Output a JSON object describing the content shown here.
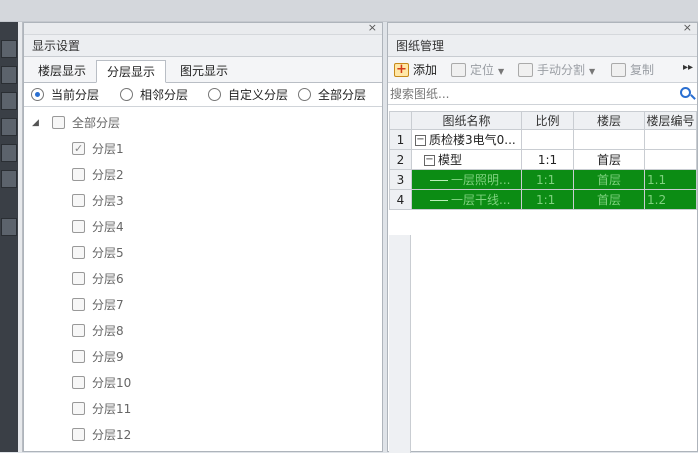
{
  "left_panel": {
    "title": "显示设置",
    "tabs": [
      "楼层显示",
      "分层显示",
      "图元显示"
    ],
    "active_tab": 1,
    "radios": [
      {
        "label": "当前分层",
        "selected": true
      },
      {
        "label": "相邻分层",
        "selected": false
      },
      {
        "label": "自定义分层",
        "selected": false
      },
      {
        "label": "全部分层",
        "selected": false
      }
    ],
    "tree": {
      "root": {
        "label": "全部分层",
        "checked": false
      },
      "items": [
        {
          "label": "分层1",
          "checked": true
        },
        {
          "label": "分层2",
          "checked": false
        },
        {
          "label": "分层3",
          "checked": false
        },
        {
          "label": "分层4",
          "checked": false
        },
        {
          "label": "分层5",
          "checked": false
        },
        {
          "label": "分层6",
          "checked": false
        },
        {
          "label": "分层7",
          "checked": false
        },
        {
          "label": "分层8",
          "checked": false
        },
        {
          "label": "分层9",
          "checked": false
        },
        {
          "label": "分层10",
          "checked": false
        },
        {
          "label": "分层11",
          "checked": false
        },
        {
          "label": "分层12",
          "checked": false
        }
      ]
    }
  },
  "right_panel": {
    "title": "图纸管理",
    "toolbar": {
      "add": "添加",
      "locate": "定位",
      "split": "手动分割",
      "copy": "复制"
    },
    "search": {
      "placeholder": "搜索图纸..."
    },
    "columns": [
      "图纸名称",
      "比例",
      "楼层",
      "楼层编号"
    ],
    "rows": [
      {
        "num": "1",
        "name": "质检楼3电气0...",
        "scale": "",
        "floor": "",
        "floor_no": "",
        "expander": "−",
        "highlight": false
      },
      {
        "num": "2",
        "name": "模型",
        "scale": "1:1",
        "floor": "首层",
        "floor_no": "",
        "expander": "−",
        "highlight": false
      },
      {
        "num": "3",
        "name": "一层照明...",
        "scale": "1:1",
        "floor": "首层",
        "floor_no": "1.1",
        "expander": "",
        "highlight": true
      },
      {
        "num": "4",
        "name": "一层干线...",
        "scale": "1:1",
        "floor": "首层",
        "floor_no": "1.2",
        "expander": "",
        "highlight": true
      }
    ]
  },
  "colors": {
    "highlight_green": "#0c8c14",
    "accent_blue": "#2a6fd1"
  }
}
